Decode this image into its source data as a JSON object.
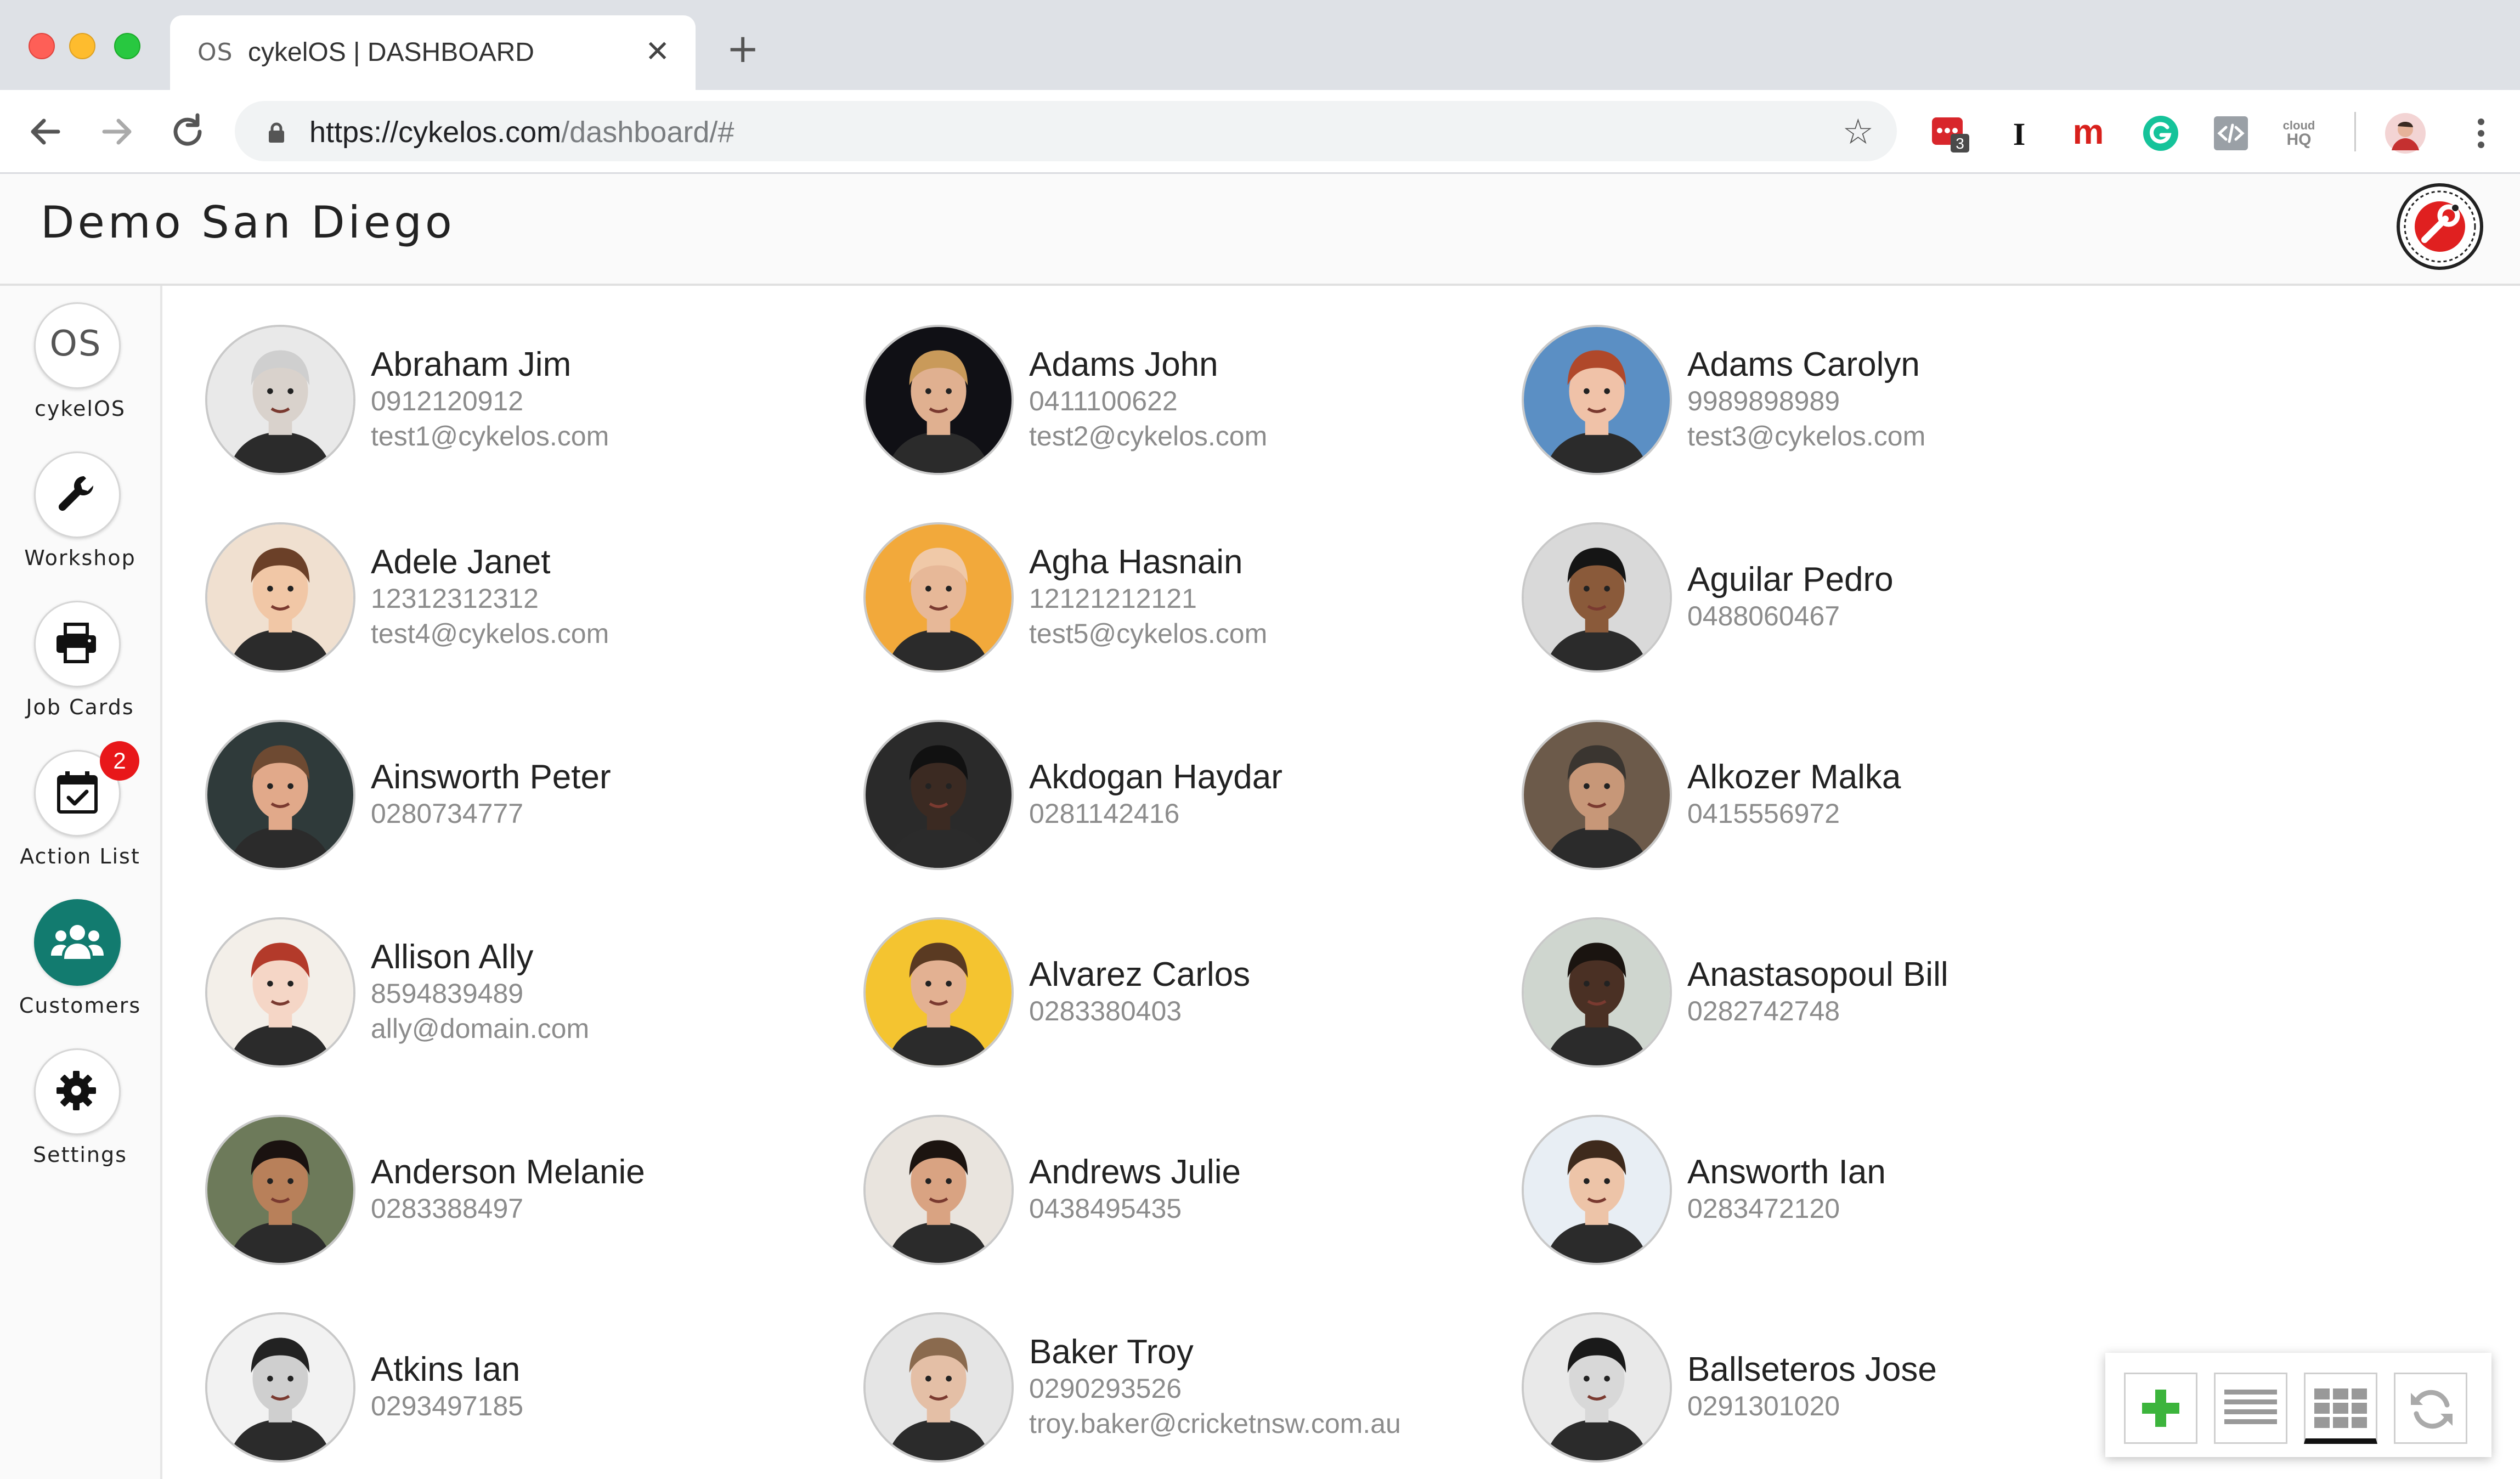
{
  "browser": {
    "tab_favicon": "OS",
    "tab_title": "cykelOS | DASHBOARD",
    "url_base": "https://cykelos.com",
    "url_path": "/dashboard/#",
    "extension_badge": "3",
    "cloudhq_label_top": "cloud",
    "cloudhq_label_bottom": "HQ"
  },
  "app": {
    "title": "Demo San Diego"
  },
  "sidebar": {
    "items": [
      {
        "label": "cykelOS",
        "icon": "os-logo-icon"
      },
      {
        "label": "Workshop",
        "icon": "wrench-icon"
      },
      {
        "label": "Job Cards",
        "icon": "printer-icon"
      },
      {
        "label": "Action List",
        "icon": "calendar-check-icon",
        "badge": "2"
      },
      {
        "label": "Customers",
        "icon": "users-icon",
        "active": true
      },
      {
        "label": "Settings",
        "icon": "gear-icon"
      }
    ],
    "os_logo_text": "OS"
  },
  "customers": [
    {
      "name": "Abraham Jim",
      "phone": "0912120912",
      "email": "test1@cykelos.com",
      "skin": "#d9d2cc",
      "bg": "#e9e9e9",
      "hair": "#cfcfcf"
    },
    {
      "name": "Adams John",
      "phone": "0411100622",
      "email": "test2@cykelos.com",
      "skin": "#e0b090",
      "bg": "#101015",
      "hair": "#c99a5a"
    },
    {
      "name": "Adams Carolyn",
      "phone": "9989898989",
      "email": "test3@cykelos.com",
      "skin": "#f0c2a8",
      "bg": "#5b8fc4",
      "hair": "#b0482a"
    },
    {
      "name": "Adele Janet",
      "phone": "12312312312",
      "email": "test4@cykelos.com",
      "skin": "#f1c7a6",
      "bg": "#f0e0d0",
      "hair": "#6b4028"
    },
    {
      "name": "Agha Hasnain",
      "phone": "12121212121",
      "email": "test5@cykelos.com",
      "skin": "#e7b898",
      "bg": "#f2a93b",
      "hair": "#f0c9a8"
    },
    {
      "name": "Aguilar Pedro",
      "phone": "0488060467",
      "email": "",
      "skin": "#8a5a3a",
      "bg": "#d9d9d9",
      "hair": "#151515"
    },
    {
      "name": "Ainsworth Peter",
      "phone": "0280734777",
      "email": "",
      "skin": "#e1a98a",
      "bg": "#2f3a3a",
      "hair": "#6e4a32"
    },
    {
      "name": "Akdogan Haydar",
      "phone": "0281142416",
      "email": "",
      "skin": "#3b2a22",
      "bg": "#2a2a2a",
      "hair": "#111111"
    },
    {
      "name": "Alkozer Malka",
      "phone": "0415556972",
      "email": "",
      "skin": "#c79778",
      "bg": "#6c5a4a",
      "hair": "#3a3530"
    },
    {
      "name": "Allison Ally",
      "phone": "8594839489",
      "email": "ally@domain.com",
      "skin": "#f5d6c6",
      "bg": "#f3efe9",
      "hair": "#b33a2a"
    },
    {
      "name": "Alvarez Carlos",
      "phone": "0283380403",
      "email": "",
      "skin": "#e3b192",
      "bg": "#f4c430",
      "hair": "#5a3a22"
    },
    {
      "name": "Anastasopoul Bill",
      "phone": "0282742748",
      "email": "",
      "skin": "#4a3024",
      "bg": "#cfd6cf",
      "hair": "#1a1410"
    },
    {
      "name": "Anderson Melanie",
      "phone": "0283388497",
      "email": "",
      "skin": "#b8805a",
      "bg": "#6d7a5a",
      "hair": "#1a1210"
    },
    {
      "name": "Andrews Julie",
      "phone": "0438495435",
      "email": "",
      "skin": "#d9a382",
      "bg": "#e9e4de",
      "hair": "#1c1410"
    },
    {
      "name": "Answorth Ian",
      "phone": "0283472120",
      "email": "",
      "skin": "#edc4a8",
      "bg": "#e8eef4",
      "hair": "#3e2a1c"
    },
    {
      "name": "Atkins Ian",
      "phone": "0293497185",
      "email": "",
      "skin": "#cfcfcf",
      "bg": "#f2f2f2",
      "hair": "#222222"
    },
    {
      "name": "Baker Troy",
      "phone": "0290293526",
      "email": "troy.baker@cricketnsw.com.au",
      "skin": "#e4bfa6",
      "bg": "#e5e5e5",
      "hair": "#8a6a4e"
    },
    {
      "name": "Ballseteros Jose",
      "phone": "0291301020",
      "email": "",
      "skin": "#d8d8d8",
      "bg": "#e9e9e9",
      "hair": "#1a1a1a"
    }
  ],
  "actions": [
    {
      "name": "add",
      "icon": "plus-icon"
    },
    {
      "name": "list-view",
      "icon": "list-icon"
    },
    {
      "name": "grid-view",
      "icon": "grid-icon",
      "active": true
    },
    {
      "name": "refresh",
      "icon": "refresh-icon"
    }
  ],
  "colors": {
    "accent": "#127b6f",
    "badge": "#e8171a",
    "add_green": "#3cb43c"
  }
}
